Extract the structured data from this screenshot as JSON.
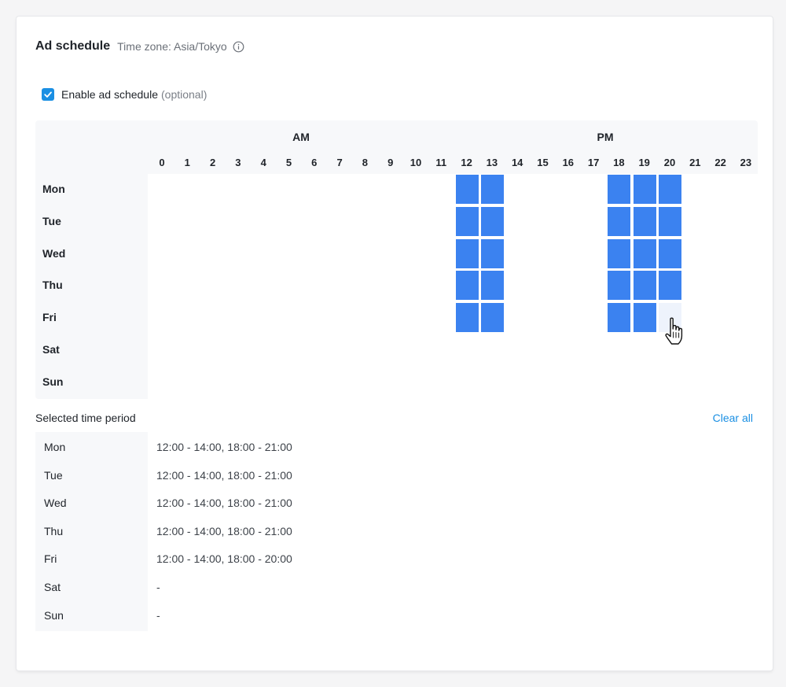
{
  "header": {
    "title": "Ad schedule",
    "timezone": "Time zone: Asia/Tokyo",
    "info_icon": "info-circle-icon"
  },
  "enable": {
    "label": "Enable ad schedule",
    "optional": "(optional)",
    "checked": true
  },
  "grid": {
    "am_label": "AM",
    "pm_label": "PM",
    "hours": [
      "0",
      "1",
      "2",
      "3",
      "4",
      "5",
      "6",
      "7",
      "8",
      "9",
      "10",
      "11",
      "12",
      "13",
      "14",
      "15",
      "16",
      "17",
      "18",
      "19",
      "20",
      "21",
      "22",
      "23"
    ],
    "days": [
      "Mon",
      "Tue",
      "Wed",
      "Thu",
      "Fri",
      "Sat",
      "Sun"
    ],
    "selected": {
      "Mon": [
        12,
        13,
        18,
        19,
        20
      ],
      "Tue": [
        12,
        13,
        18,
        19,
        20
      ],
      "Wed": [
        12,
        13,
        18,
        19,
        20
      ],
      "Thu": [
        12,
        13,
        18,
        19,
        20
      ],
      "Fri": [
        12,
        13,
        18,
        19
      ],
      "Sat": [],
      "Sun": []
    },
    "hover": {
      "day": "Fri",
      "hour": 20
    },
    "selected_color": "#3b82f0",
    "hover_color": "#eef3fc"
  },
  "selection": {
    "title": "Selected time period",
    "clear_label": "Clear all",
    "rows": [
      {
        "day": "Mon",
        "value": "12:00 - 14:00, 18:00 - 21:00"
      },
      {
        "day": "Tue",
        "value": "12:00 - 14:00, 18:00 - 21:00"
      },
      {
        "day": "Wed",
        "value": "12:00 - 14:00, 18:00 - 21:00"
      },
      {
        "day": "Thu",
        "value": "12:00 - 14:00, 18:00 - 21:00"
      },
      {
        "day": "Fri",
        "value": "12:00 - 14:00, 18:00 - 20:00"
      },
      {
        "day": "Sat",
        "value": "-"
      },
      {
        "day": "Sun",
        "value": "-"
      }
    ]
  },
  "accent_color": "#1a8fe3",
  "cursor_icon": "hand-pointer-icon"
}
